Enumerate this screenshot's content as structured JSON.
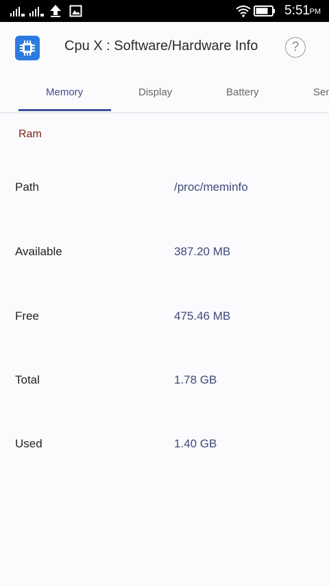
{
  "status_bar": {
    "time": "5:51",
    "ampm": "PM",
    "icons": [
      "signal-1-icon",
      "signal-2-icon",
      "upload-icon",
      "image-icon",
      "wifi-icon",
      "battery-icon"
    ]
  },
  "app_bar": {
    "title": "Cpu X : Software/Hardware Info",
    "help_label": "?",
    "logo_icon": "cpu-chip-icon"
  },
  "tabs": [
    {
      "label": "Memory",
      "active": true
    },
    {
      "label": "Display",
      "active": false
    },
    {
      "label": "Battery",
      "active": false
    },
    {
      "label": "Sen",
      "active": false
    }
  ],
  "section": {
    "title": "Ram"
  },
  "rows": [
    {
      "label": "Path",
      "value": "/proc/meminfo"
    },
    {
      "label": "Available",
      "value": "387.20 MB"
    },
    {
      "label": "Free",
      "value": "475.46 MB"
    },
    {
      "label": "Total",
      "value": "1.78 GB"
    },
    {
      "label": "Used",
      "value": "1.40 GB"
    }
  ],
  "colors": {
    "accent": "#3c4f98",
    "section_title": "#7a1d12",
    "value_text": "#3e4978",
    "logo": "#2d7be0"
  }
}
